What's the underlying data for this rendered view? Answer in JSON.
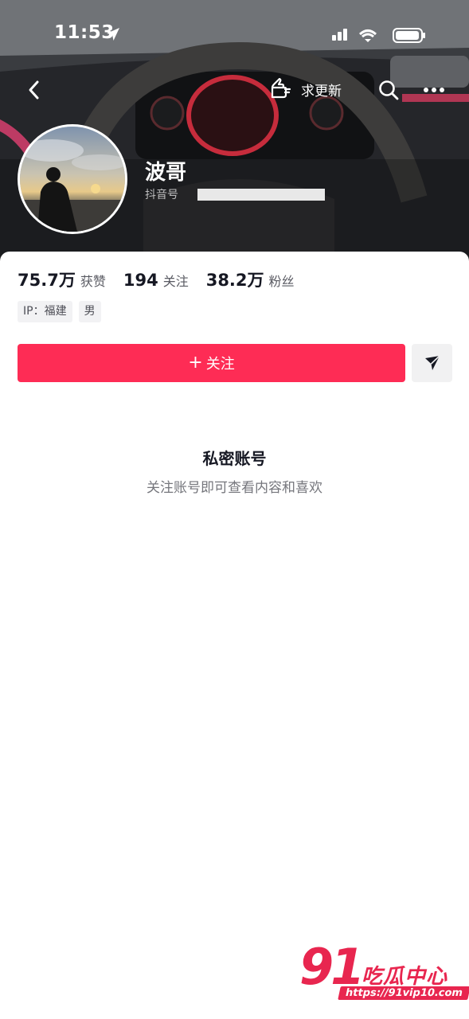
{
  "status_bar": {
    "time": "11:53"
  },
  "nav": {
    "update_label": "求更新"
  },
  "profile": {
    "name": "波哥",
    "id_label": "抖音号"
  },
  "stats": [
    {
      "value": "75.7万",
      "label": "获赞"
    },
    {
      "value": "194",
      "label": "关注"
    },
    {
      "value": "38.2万",
      "label": "粉丝"
    }
  ],
  "tags": [
    "IP：福建",
    "男"
  ],
  "actions": {
    "follow_plus": "+",
    "follow_label": "关注"
  },
  "private": {
    "title": "私密账号",
    "subtitle": "关注账号即可查看内容和喜欢"
  },
  "watermark": {
    "number": "91",
    "text": "吃瓜中心",
    "url": "https://91vip10.com"
  },
  "colors": {
    "accent": "#fe2c55",
    "text_primary": "#161823",
    "text_secondary": "#75767c",
    "watermark": "#e8264f"
  }
}
